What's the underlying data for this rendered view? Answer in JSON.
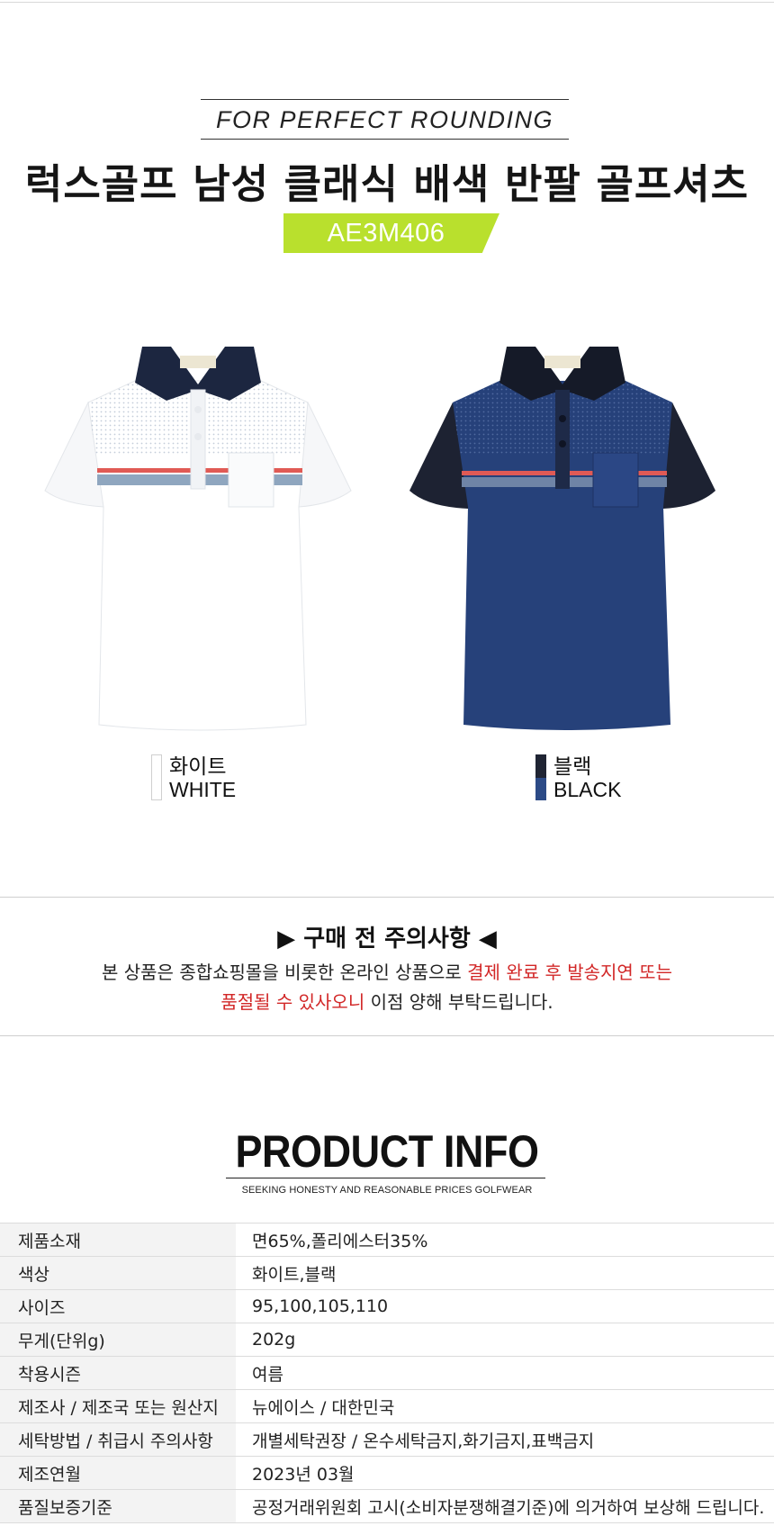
{
  "header": {
    "tagline": "FOR PERFECT ROUNDING",
    "title": "럭스골프 남성 클래식 배색 반팔 골프셔츠",
    "model_code": "AE3M406",
    "badge_color": "#b9e02d"
  },
  "colors": [
    {
      "name_ko": "화이트",
      "name_en": "WHITE",
      "swatch": [
        "#ffffff",
        "#ffffff"
      ]
    },
    {
      "name_ko": "블랙",
      "name_en": "BLACK",
      "swatch": [
        "#1f2433",
        "#2c4a86"
      ]
    }
  ],
  "notice": {
    "title": "▶ 구매 전 주의사항 ◀",
    "line1_normal": "본 상품은 종합쇼핑몰을 비롯한 온라인 상품으로 ",
    "line1_red": "결제 완료 후 발송지연 또는",
    "line2_red": "품절될 수 있사오니",
    "line2_normal": " 이점 양해 부탁드립니다."
  },
  "product_info": {
    "heading": "PRODUCT INFO",
    "subheading": "SEEKING HONESTY AND REASONABLE PRICES GOLFWEAR",
    "rows": [
      {
        "key": "제품소재",
        "value": "면65%,폴리에스터35%"
      },
      {
        "key": "색상",
        "value": "화이트,블랙"
      },
      {
        "key": "사이즈",
        "value": "95,100,105,110"
      },
      {
        "key": "무게(단위g)",
        "value": "202g"
      },
      {
        "key": "착용시즌",
        "value": "여름"
      },
      {
        "key": "제조사 / 제조국 또는 원산지",
        "value": "뉴에이스 / 대한민국"
      },
      {
        "key": "세탁방법 / 취급시 주의사항",
        "value": "개별세탁권장 / 온수세탁금지,화기금지,표백금지"
      },
      {
        "key": "제조연월",
        "value": "2023년 03월"
      },
      {
        "key": "품질보증기준",
        "value": "공정거래위원회 고시(소비자분쟁해결기준)에 의거하여  보상해 드립니다."
      }
    ]
  }
}
